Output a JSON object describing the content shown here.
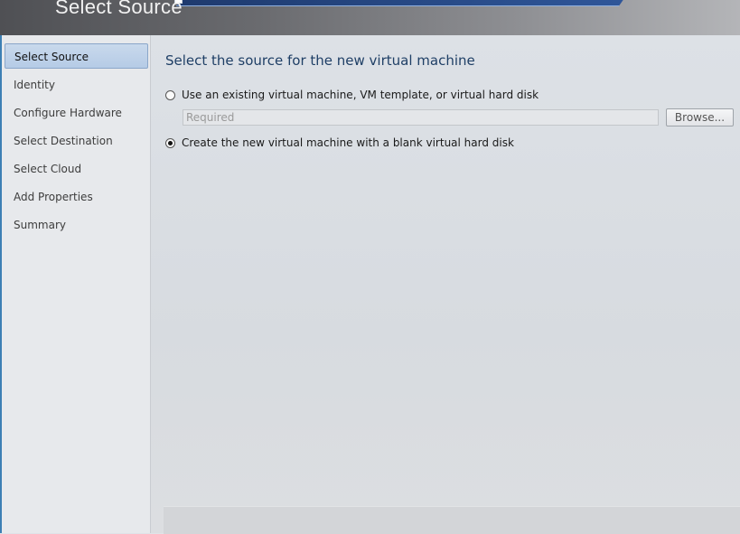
{
  "header": {
    "title": "Select Source"
  },
  "nav": {
    "items": [
      {
        "label": "Select Source",
        "selected": true
      },
      {
        "label": "Identity",
        "selected": false
      },
      {
        "label": "Configure Hardware",
        "selected": false
      },
      {
        "label": "Select Destination",
        "selected": false
      },
      {
        "label": "Select Cloud",
        "selected": false
      },
      {
        "label": "Add Properties",
        "selected": false
      },
      {
        "label": "Summary",
        "selected": false
      }
    ]
  },
  "content": {
    "title": "Select the source for the new virtual machine",
    "option_existing": {
      "label": "Use an existing virtual machine, VM template, or virtual hard disk",
      "checked": false
    },
    "path_field": {
      "value": "",
      "placeholder": "Required"
    },
    "browse_label": "Browse...",
    "option_blank": {
      "label": "Create the new virtual machine with a blank virtual hard disk",
      "checked": true
    }
  },
  "colors": {
    "nav_accent": "#3c7fb4",
    "title_text": "#1f3f66",
    "selected_nav_bg": "#b5cbe6"
  }
}
